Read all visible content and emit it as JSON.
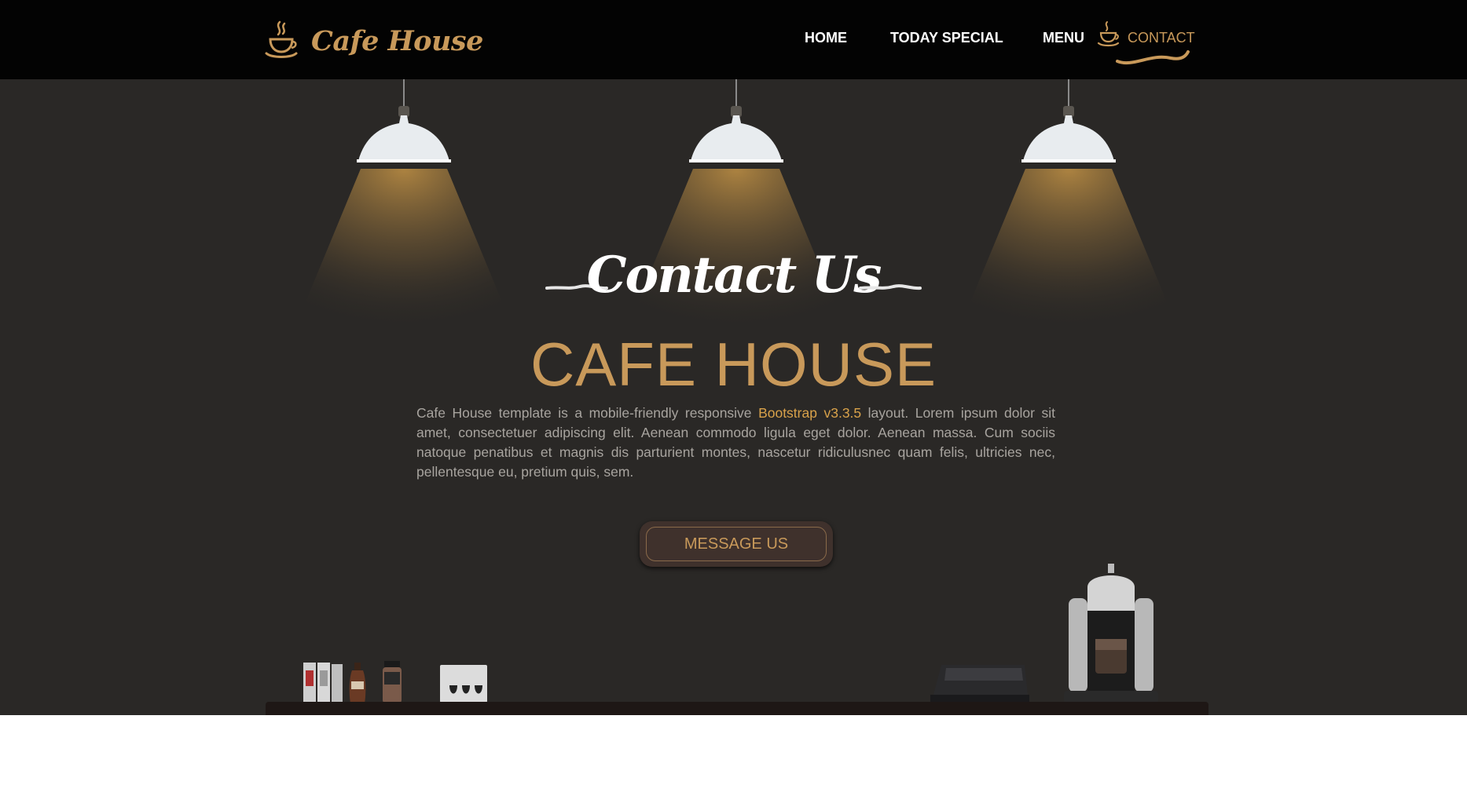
{
  "brand": {
    "name": "Cafe House",
    "logo_icon": "coffee-cup-icon"
  },
  "nav": {
    "items": [
      {
        "label": "HOME",
        "active": false
      },
      {
        "label": "TODAY SPECIAL",
        "active": false
      },
      {
        "label": "MENU",
        "active": false
      },
      {
        "label": "CONTACT",
        "active": true
      }
    ],
    "active_icon": "coffee-cup-icon"
  },
  "hero": {
    "script_title": "Contact Us",
    "title": "CAFE HOUSE",
    "description": {
      "before": "Cafe House template is a mobile-friendly responsive ",
      "highlight": "Bootstrap v3.3.5",
      "after": " layout. Lorem ipsum dolor sit amet, consectetuer adipiscing elit. Aenean commodo ligula eget dolor. Aenean massa. Cum sociis natoque penatibus et magnis dis parturient montes, nascetur ridiculusnec quam felis, ultricies nec, pellentesque eu, pretium quis, sem."
    },
    "button_label": "MESSAGE US"
  },
  "colors": {
    "navbar_bg": "#030303",
    "hero_bg": "#2a2826",
    "accent": "#c8995a",
    "highlight": "#d9a24a",
    "body_text": "#a8a49f",
    "button_bg": "#3f312c"
  }
}
